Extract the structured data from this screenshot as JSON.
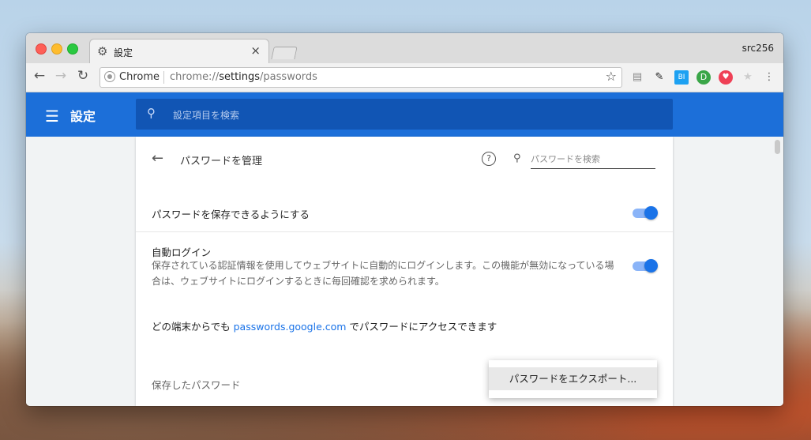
{
  "tab": {
    "title": "設定",
    "close": "×",
    "icon": "gear-icon"
  },
  "profile_name": "src256",
  "nav": {
    "back": "←",
    "forward": "→",
    "reload": "↻"
  },
  "omnibox": {
    "chrome_label": "Chrome",
    "url_prefix": "chrome://",
    "url_host": "settings",
    "url_path": "/passwords",
    "star": "☆"
  },
  "extensions": [
    {
      "name": "ext-1",
      "glyph": "▤",
      "color": "#888888"
    },
    {
      "name": "pin",
      "glyph": "✎",
      "color": "#222222"
    },
    {
      "name": "bi",
      "glyph": "BI",
      "color": "#1da1f2"
    },
    {
      "name": "d",
      "glyph": "D",
      "color": "#3aa648"
    },
    {
      "name": "pocket",
      "glyph": "♥",
      "color": "#ef4056"
    },
    {
      "name": "star-ext",
      "glyph": "★",
      "color": "#cccccc"
    },
    {
      "name": "menu",
      "glyph": "⋮",
      "color": "#555555"
    }
  ],
  "header": {
    "menu_glyph": "☰",
    "title": "設定",
    "search_placeholder": "設定項目を検索",
    "search_glyph": "⚲"
  },
  "page": {
    "back_glyph": "←",
    "title": "パスワードを管理",
    "help_glyph": "?",
    "search_placeholder": "パスワードを検索",
    "offer_save_label": "パスワードを保存できるようにする",
    "offer_save_on": true,
    "autologin_label": "自動ログイン",
    "autologin_desc": "保存されている認証情報を使用してウェブサイトに自動的にログインします。この機能が無効になっている場合は、ウェブサイトにログインするときに毎回確認を求められます。",
    "autologin_on": true,
    "access_prefix": "どの端末からでも ",
    "access_link": "passwords.google.com",
    "access_suffix": " でパスワードにアクセスできます",
    "saved_label": "保存したパスワード"
  },
  "menu": {
    "export_label": "パスワードをエクスポート..."
  }
}
